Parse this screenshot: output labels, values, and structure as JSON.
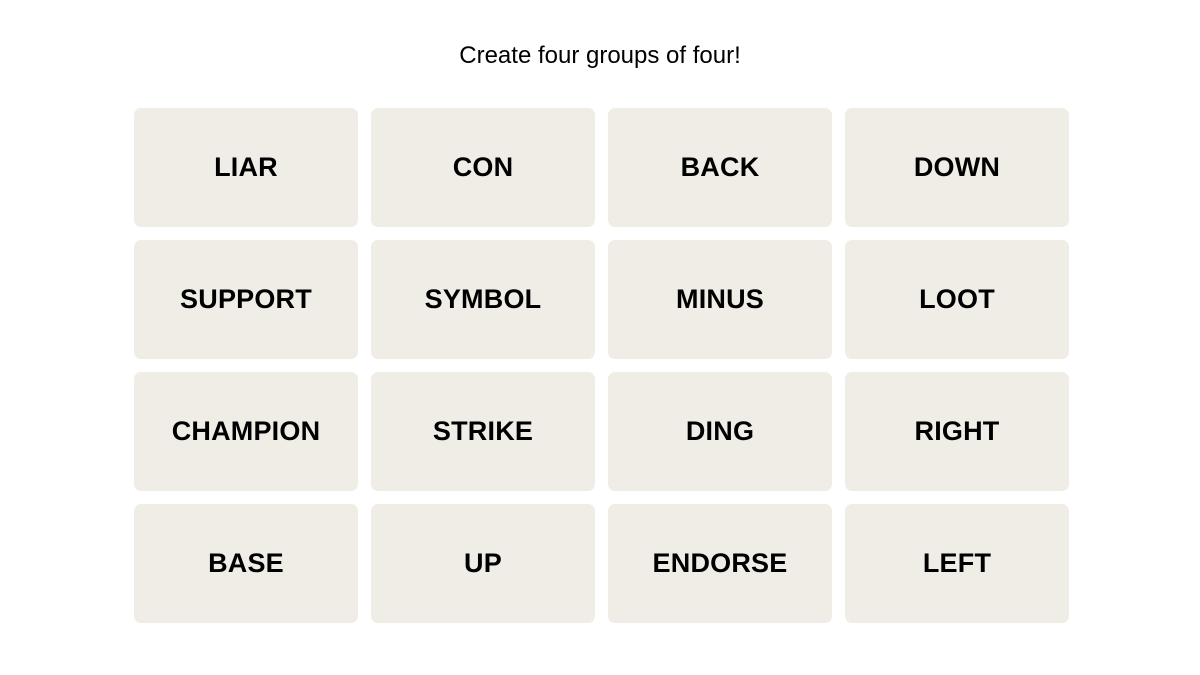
{
  "instructions": "Create four groups of four!",
  "colors": {
    "tile_bg": "#efede6",
    "text": "#000000",
    "page_bg": "#ffffff"
  },
  "tiles": [
    {
      "label": "LIAR"
    },
    {
      "label": "CON"
    },
    {
      "label": "BACK"
    },
    {
      "label": "DOWN"
    },
    {
      "label": "SUPPORT"
    },
    {
      "label": "SYMBOL"
    },
    {
      "label": "MINUS"
    },
    {
      "label": "LOOT"
    },
    {
      "label": "CHAMPION"
    },
    {
      "label": "STRIKE"
    },
    {
      "label": "DING"
    },
    {
      "label": "RIGHT"
    },
    {
      "label": "BASE"
    },
    {
      "label": "UP"
    },
    {
      "label": "ENDORSE"
    },
    {
      "label": "LEFT"
    }
  ]
}
